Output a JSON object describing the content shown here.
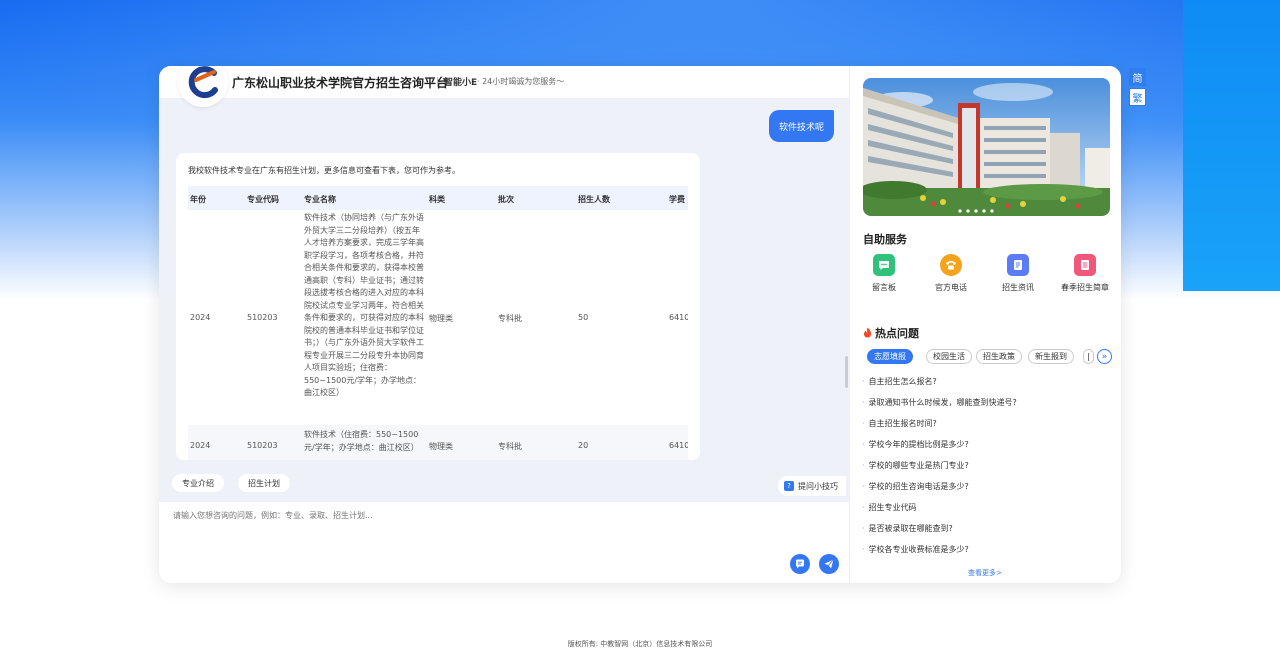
{
  "lang": {
    "simplified": "简",
    "traditional": "繁"
  },
  "header": {
    "title": "广东松山职业技术学院官方招生咨询平台",
    "brand": "智能小E",
    "subtitle": "· 24小时竭诚为您服务～"
  },
  "chat": {
    "user_message": "软件技术呢",
    "answer_intro": "我校软件技术专业在广东有招生计划，更多信息可查看下表，您可作为参考。",
    "table": {
      "headers": [
        "年份",
        "专业代码",
        "专业名称",
        "科类",
        "批次",
        "招生人数",
        "学费"
      ],
      "rows": [
        {
          "year": "2024",
          "code": "510203",
          "name": "软件技术（协同培养（与广东外语外贸大学三二分段培养）（按五年人才培养方案要求，完成三学年高职学段学习，各项考核合格，并符合相关条件和要求的，获得本校普通高职（专科）毕业证书；通过转段选拔考核合格的进入对应的本科院校试点专业学习两年，符合相关条件和要求的，可获得对应的本科院校的普通本科毕业证书和学位证书；）（与广东外语外贸大学软件工程专业开展三二分段专升本协同育人项目实验班；住宿费：550~1500元/学年；办学地点：曲江校区）",
          "category": "物理类",
          "batch": "专科批",
          "count": "50",
          "fee": "6410"
        },
        {
          "year": "2024",
          "code": "510203",
          "name": "软件技术（住宿费：550~1500元/学年；办学地点：曲江校区）",
          "category": "物理类",
          "batch": "专科批",
          "count": "20",
          "fee": "6410"
        }
      ]
    }
  },
  "quick_chips": [
    "专业介绍",
    "招生计划"
  ],
  "tips_label": "提问小技巧",
  "input": {
    "placeholder": "请输入您想咨询的问题，例如：专业、录取、招生计划..."
  },
  "services": {
    "title": "自助服务",
    "items": [
      {
        "label": "留言板",
        "icon": "message-board-icon",
        "color": "#2fc27a"
      },
      {
        "label": "官方电话",
        "icon": "phone-icon",
        "color": "#f5a31a"
      },
      {
        "label": "招生资讯",
        "icon": "news-icon",
        "color": "#5b7cf6"
      },
      {
        "label": "春季招生简章",
        "icon": "brochure-icon",
        "color": "#f0577a"
      }
    ]
  },
  "hot": {
    "title": "热点问题",
    "tabs": [
      "志愿填报",
      "校园生活",
      "招生政策",
      "新生报到",
      "|"
    ],
    "questions": [
      "自主招生怎么报名?",
      "录取通知书什么时候发，哪能查到快递号?",
      "自主招生报名时间?",
      "学校今年的提档比例是多少?",
      "学校的哪些专业是热门专业?",
      "学校的招生咨询电话是多少?",
      "招生专业代码",
      "是否被录取在哪能查到?",
      "学校各专业收费标准是多少?"
    ],
    "more": "查看更多>"
  },
  "footer": "版权所有: 中教智网（北京）信息技术有限公司"
}
